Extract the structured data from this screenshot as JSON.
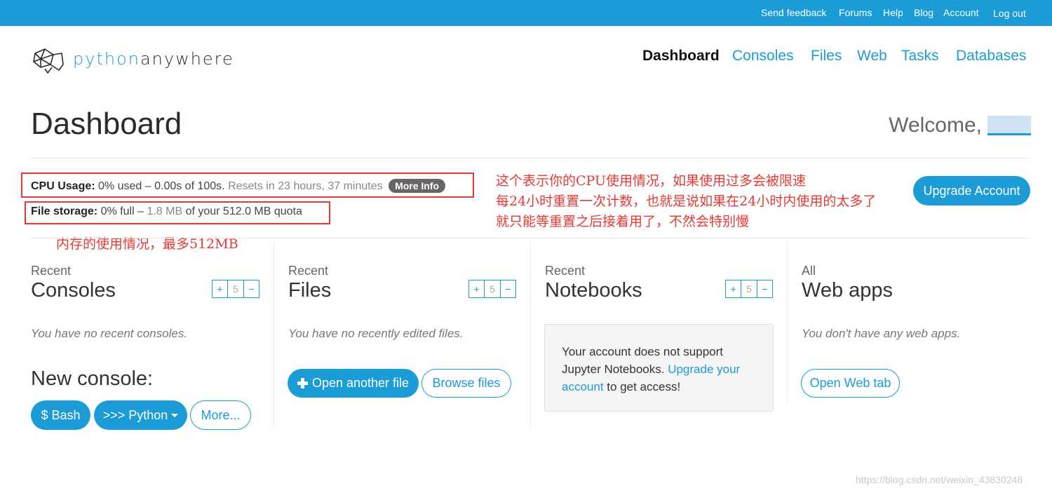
{
  "topbar": {
    "links": [
      "Send feedback",
      "Forums",
      "Help",
      "Blog",
      "Account",
      "Log out"
    ]
  },
  "logo": {
    "part1": "python",
    "part2": "anywhere"
  },
  "nav": {
    "dashboard": "Dashboard",
    "consoles": "Consoles",
    "files": "Files",
    "web": "Web",
    "tasks": "Tasks",
    "databases": "Databases"
  },
  "page": {
    "title": "Dashboard",
    "welcome": "Welcome,"
  },
  "usage": {
    "cpu_label": "CPU Usage:",
    "cpu_used": "0% used",
    "cpu_detail": "0.00s of 100s.",
    "cpu_reset": "Resets in 23 hours, 37 minutes",
    "more_info": "More Info",
    "file_label": "File storage:",
    "file_full": "0% full",
    "file_used": "1.8 MB",
    "file_quota": "of your 512.0 MB quota"
  },
  "upgrade_button": "Upgrade Account",
  "annotations": {
    "cpu_line1": "这个表示你的CPU使用情况，如果使用过多会被限速",
    "cpu_line2": "每24小时重置一次计数，也就是说如果在24小时内使用的太多了",
    "cpu_line3": "就只能等重置之后接着用了，不然会特别慢",
    "storage": "内存的使用情况，最多512MB"
  },
  "columns": {
    "consoles": {
      "label": "Recent",
      "title": "Consoles",
      "stepper": {
        "plus": "+",
        "count": "5",
        "minus": "−"
      },
      "empty": "You have no recent consoles.",
      "new_console": "New console:",
      "buttons": {
        "bash": "$ Bash",
        "python": ">>> Python",
        "more": "More..."
      }
    },
    "files": {
      "label": "Recent",
      "title": "Files",
      "stepper": {
        "plus": "+",
        "count": "5",
        "minus": "−"
      },
      "empty": "You have no recently edited files.",
      "open_another": "Open another file",
      "browse": "Browse files"
    },
    "notebooks": {
      "label": "Recent",
      "title": "Notebooks",
      "stepper": {
        "plus": "+",
        "count": "5",
        "minus": "−"
      },
      "message_start": "Your account does not support Jupyter Notebooks.",
      "message_link": "Upgrade your account",
      "message_end": "to get access!"
    },
    "webapps": {
      "label": "All",
      "title": "Web apps",
      "empty": "You don't have any web apps.",
      "open_web_tab": "Open Web tab"
    }
  },
  "watermark": "https://blog.csdn.net/weixin_43830248",
  "colors": {
    "brand": "#1b9cd6",
    "annotation": "#e53935",
    "badge": "#666666"
  },
  "icons": [
    "python-anywhere-logo-icon",
    "plus-icon",
    "caret-down-icon"
  ]
}
